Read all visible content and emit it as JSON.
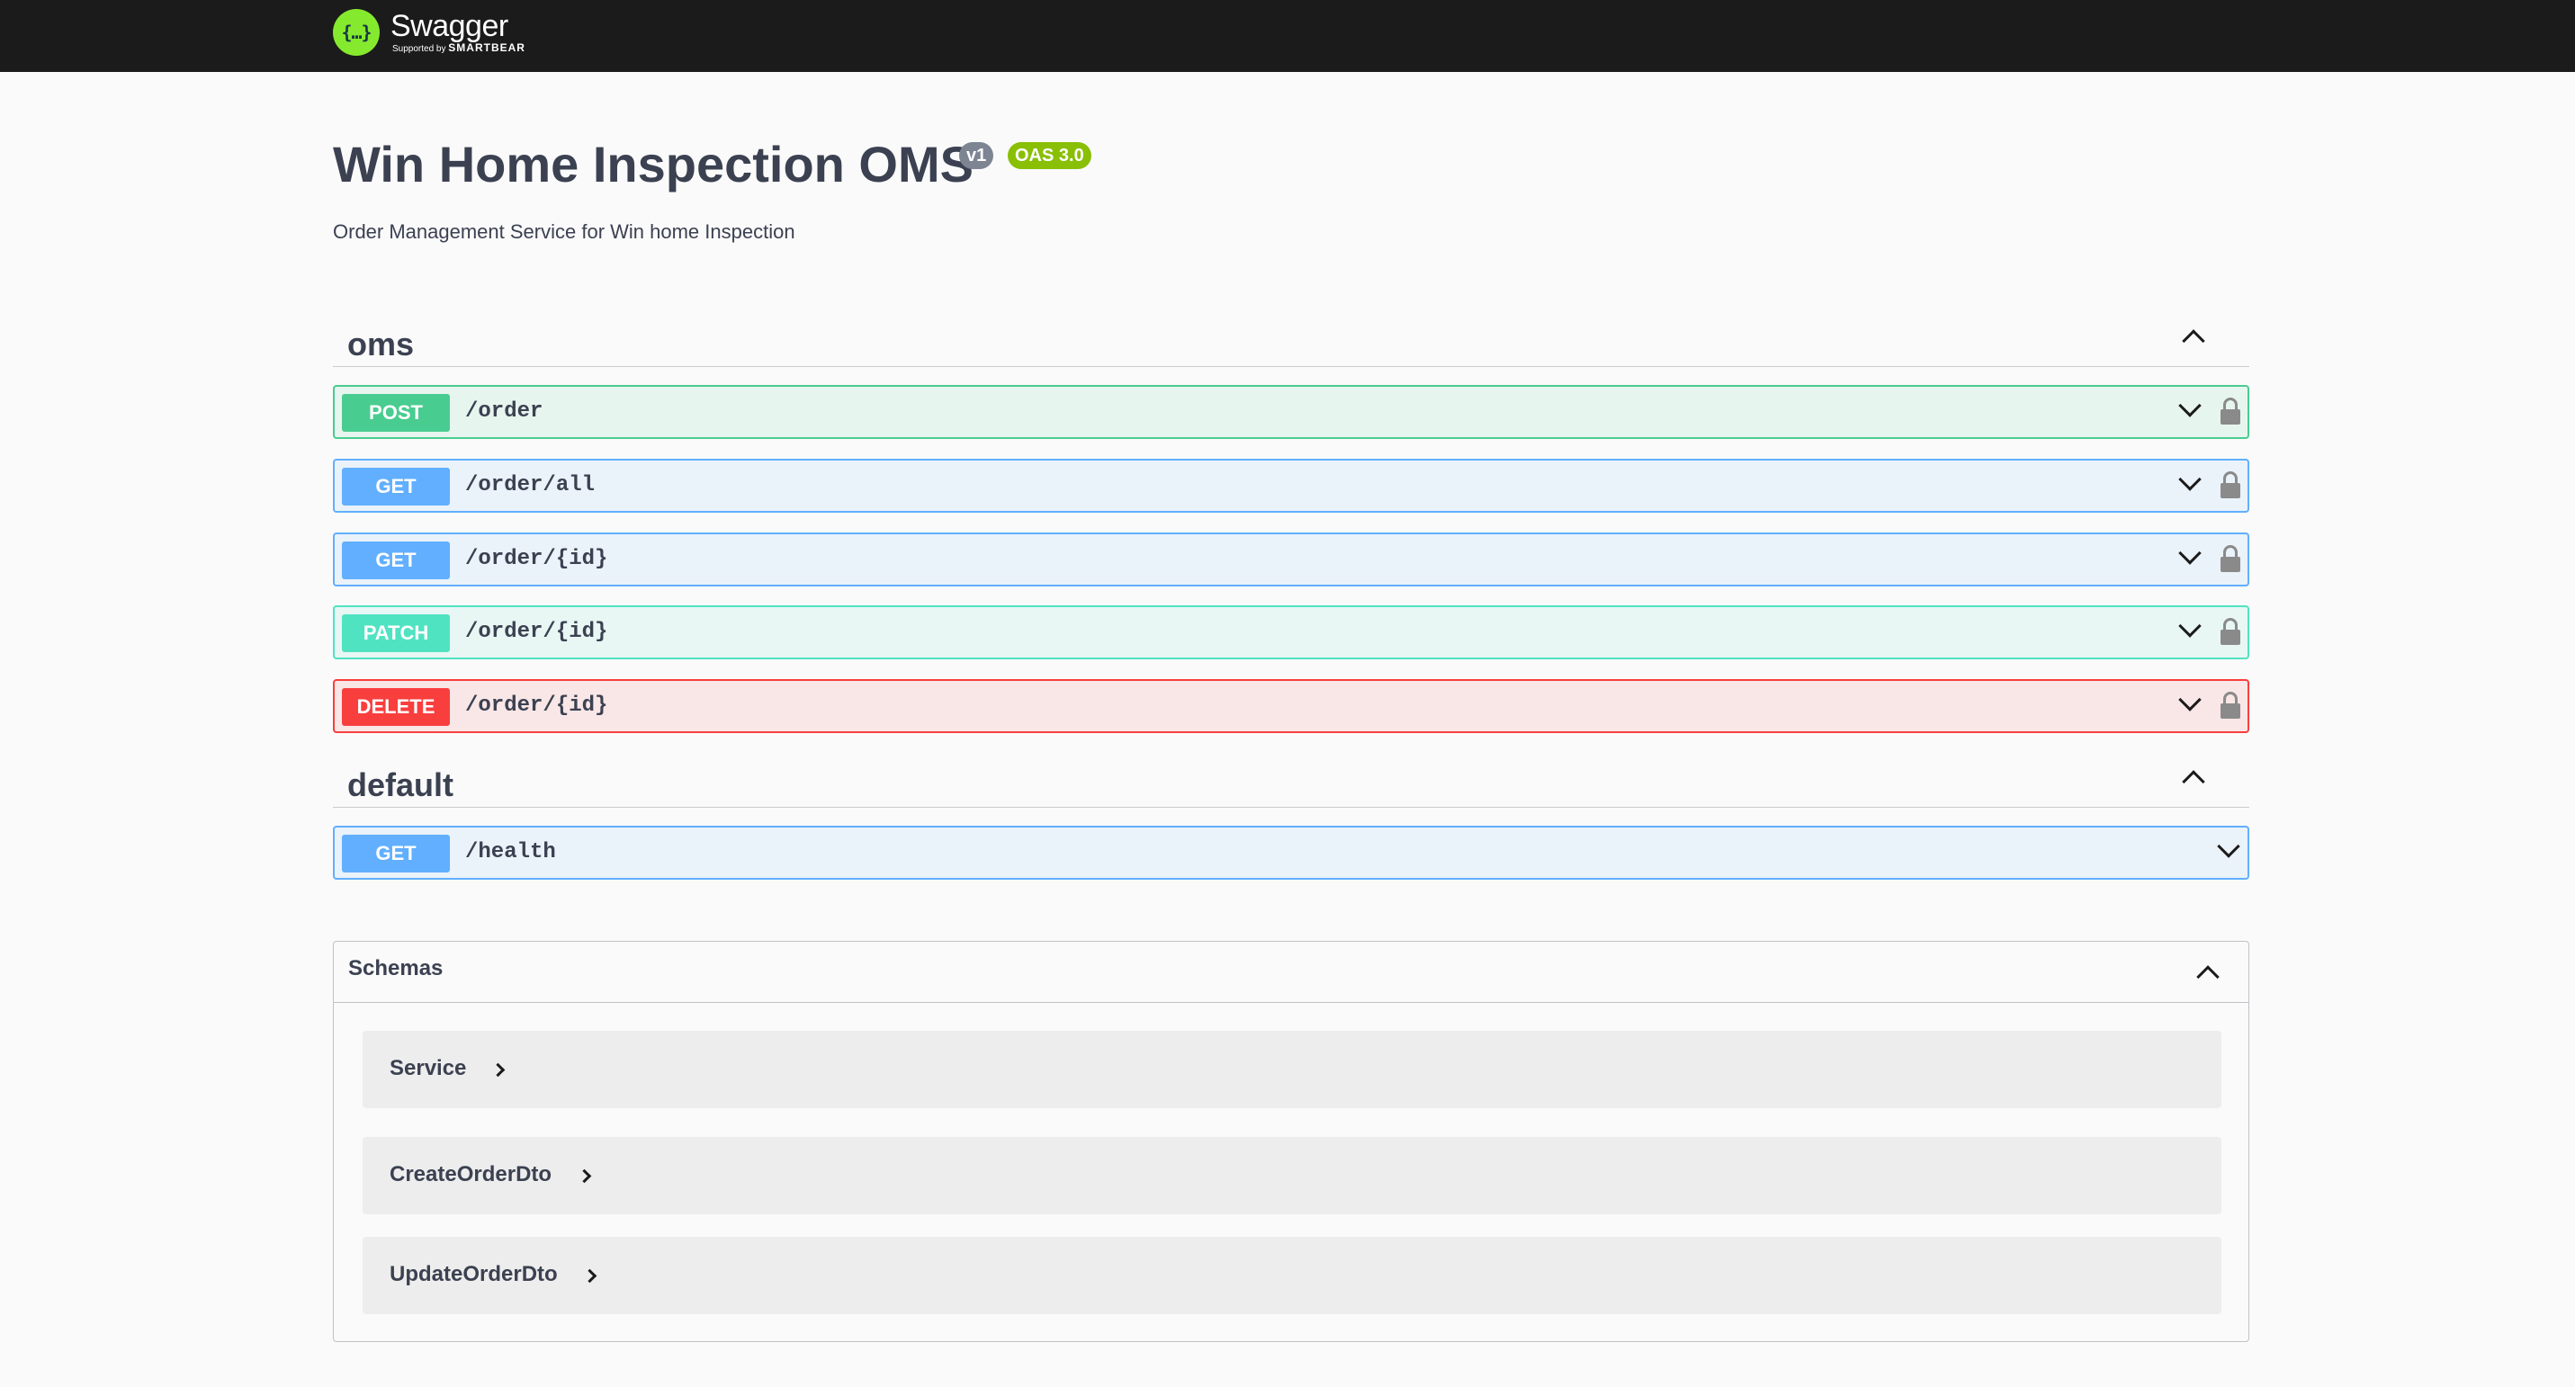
{
  "brand": {
    "logo_glyph": "{…}",
    "name": "Swagger",
    "supported_prefix": "Supported by",
    "supported_by": "SMARTBEAR"
  },
  "info": {
    "title": "Win Home Inspection OMS",
    "version_badge": "v1",
    "oas_badge": "OAS 3.0",
    "description": "Order Management Service for Win home Inspection"
  },
  "tags": [
    {
      "name": "oms",
      "operations": [
        {
          "method": "POST",
          "path": "/order",
          "locked": true
        },
        {
          "method": "GET",
          "path": "/order/all",
          "locked": true
        },
        {
          "method": "GET",
          "path": "/order/{id}",
          "locked": true
        },
        {
          "method": "PATCH",
          "path": "/order/{id}",
          "locked": true
        },
        {
          "method": "DELETE",
          "path": "/order/{id}",
          "locked": true
        }
      ]
    },
    {
      "name": "default",
      "operations": [
        {
          "method": "GET",
          "path": "/health",
          "locked": false
        }
      ]
    }
  ],
  "schemas": {
    "title": "Schemas",
    "models": [
      "Service",
      "CreateOrderDto",
      "UpdateOrderDto"
    ]
  },
  "colors": {
    "post": "#49cc90",
    "get": "#61affe",
    "patch": "#50e3c2",
    "delete": "#f93e3e",
    "brand_green": "#85ea2d",
    "topbar": "#1b1b1b"
  }
}
